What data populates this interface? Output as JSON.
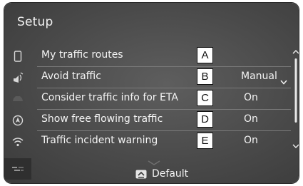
{
  "header": {
    "title": "Setup"
  },
  "sidebar": {
    "icons": [
      "phone-icon",
      "route-audio-icon",
      "car-icon",
      "navigation-icon",
      "wifi-icon",
      "traffic-icon"
    ]
  },
  "settings": {
    "rows": [
      {
        "label": "My traffic routes",
        "callout": "A",
        "value": ""
      },
      {
        "label": "Avoid traffic",
        "callout": "B",
        "value": "Manual"
      },
      {
        "label": "Consider traffic info for ETA",
        "callout": "C",
        "value": "On"
      },
      {
        "label": "Show free flowing traffic",
        "callout": "D",
        "value": "On"
      },
      {
        "label": "Traffic incident warning",
        "callout": "E",
        "value": "On"
      }
    ]
  },
  "footer": {
    "default_label": "Default"
  },
  "colors": {
    "screen_bg": "#4a4a4a",
    "text": "#f4f4f4",
    "callout_bg": "#ffffff"
  }
}
